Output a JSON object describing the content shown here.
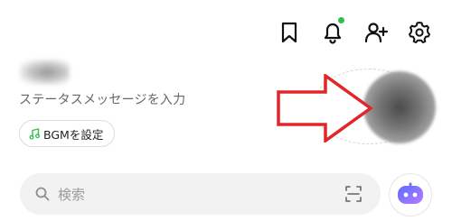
{
  "header": {
    "icons": [
      "bookmark-icon",
      "bell-icon",
      "add-friend-icon",
      "settings-icon"
    ],
    "notification_dot_color": "#2fbf4d"
  },
  "profile": {
    "status_message_placeholder": "ステータスメッセージを入力",
    "bgm_button_label": "BGMを設定",
    "bgm_icon_color": "#2fbf4d"
  },
  "annotation": {
    "arrow_color": "#e0262a"
  },
  "search": {
    "placeholder": "検索",
    "scan_icon": "qr-scan-icon"
  },
  "ai_button": {
    "icon": "ai-bot-icon",
    "colors": [
      "#5b6cff",
      "#b57cff"
    ]
  }
}
